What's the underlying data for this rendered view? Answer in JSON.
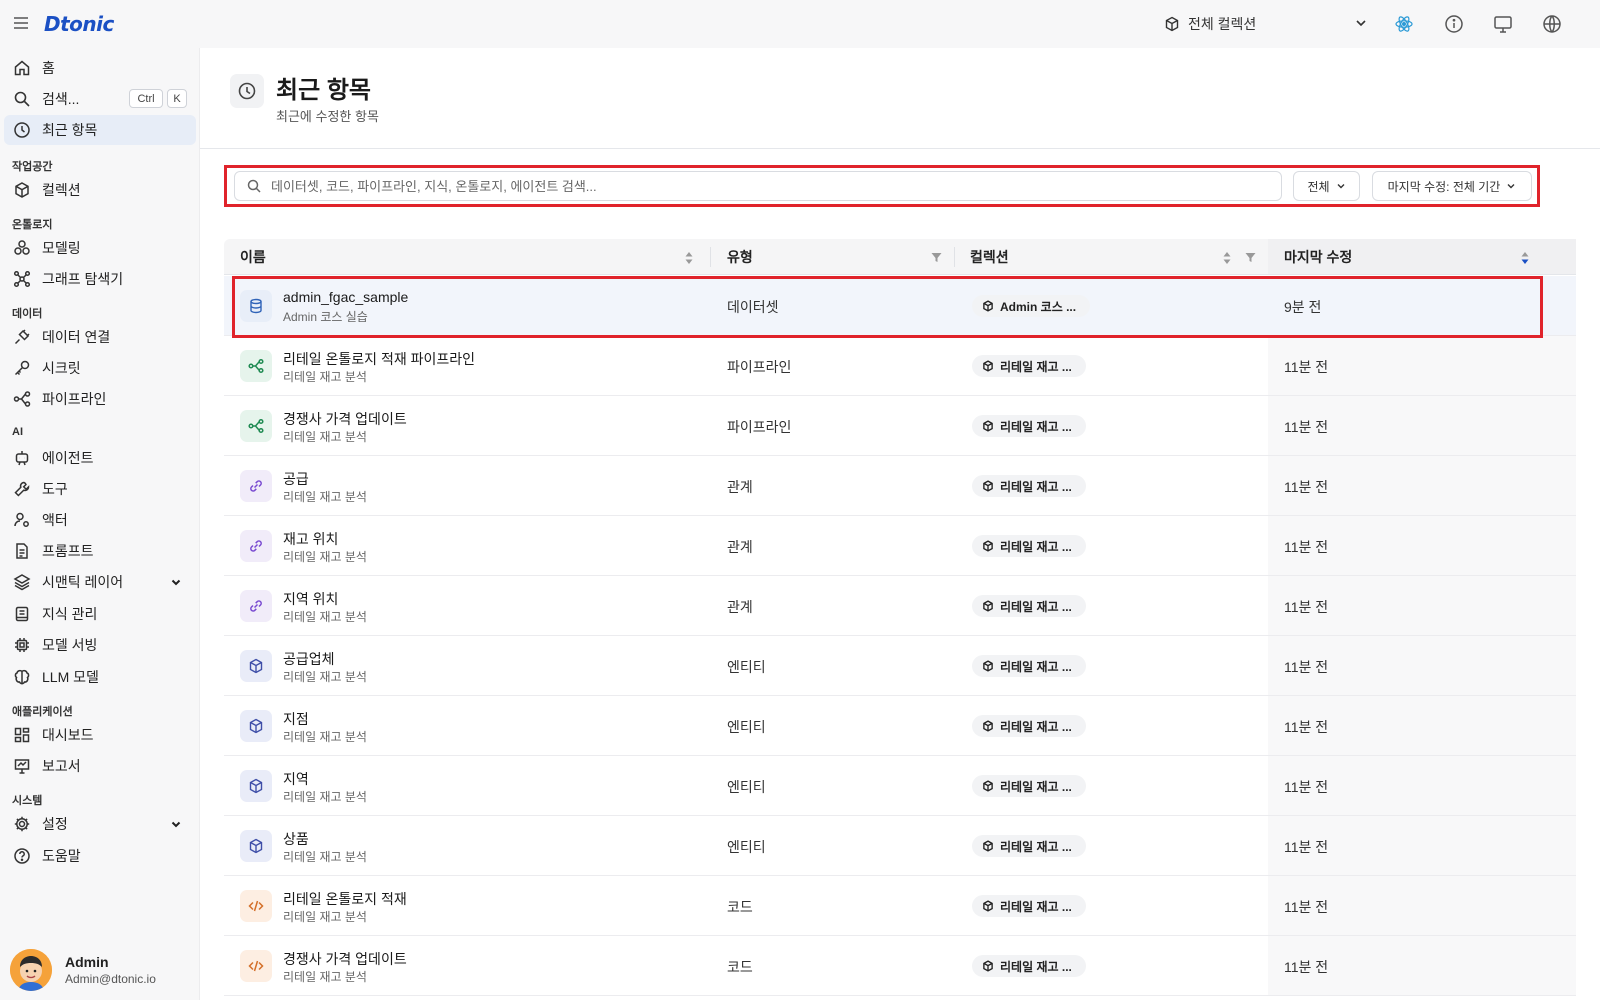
{
  "app": {
    "logo": "Dtonic"
  },
  "header": {
    "collection_selector": "전체 컬렉션"
  },
  "sidebar": {
    "items": {
      "home": "홈",
      "search": "검색...",
      "search_kbd": [
        "Ctrl",
        "K"
      ],
      "recent": "최근 항목",
      "collections": "컬렉션",
      "modeling": "모델링",
      "graph_explorer": "그래프 탐색기",
      "data_connection": "데이터 연결",
      "secret": "시크릿",
      "pipeline": "파이프라인",
      "agent": "에이전트",
      "tool": "도구",
      "actor": "액터",
      "prompt": "프롬프트",
      "semantic_layer": "시맨틱 레이어",
      "knowledge": "지식 관리",
      "model_serving": "모델 서빙",
      "llm_model": "LLM 모델",
      "dashboard": "대시보드",
      "report": "보고서",
      "settings": "설정",
      "help": "도움말"
    },
    "sections": {
      "workspace": "작업공간",
      "ontology": "온톨로지",
      "data": "데이터",
      "ai": "AI",
      "application": "애플리케이션",
      "system": "시스템"
    },
    "user": {
      "name": "Admin",
      "email": "Admin@dtonic.io"
    }
  },
  "page": {
    "title": "최근 항목",
    "subtitle": "최근에 수정한 항목"
  },
  "filters": {
    "search_placeholder": "데이터셋, 코드, 파이프라인, 지식, 온톨로지, 에이전트 검색...",
    "type_filter": "전체",
    "date_filter": "마지막 수정: 전체 기간"
  },
  "table": {
    "columns": {
      "name": "이름",
      "type": "유형",
      "collection": "컬렉션",
      "modified": "마지막 수정"
    },
    "rows": [
      {
        "name": "admin_fgac_sample",
        "sub": "Admin 코스 실습",
        "type": "데이터셋",
        "collection": "Admin 코스 ...",
        "modified": "9분 전",
        "icon": "database-icon"
      },
      {
        "name": "리테일 온톨로지 적재 파이프라인",
        "sub": "리테일 재고 분석",
        "type": "파이프라인",
        "collection": "리테일 재고 ...",
        "modified": "11분 전",
        "icon": "pipeline-icon"
      },
      {
        "name": "경쟁사 가격 업데이트",
        "sub": "리테일 재고 분석",
        "type": "파이프라인",
        "collection": "리테일 재고 ...",
        "modified": "11분 전",
        "icon": "pipeline-icon"
      },
      {
        "name": "공급",
        "sub": "리테일 재고 분석",
        "type": "관계",
        "collection": "리테일 재고 ...",
        "modified": "11분 전",
        "icon": "link-icon"
      },
      {
        "name": "재고 위치",
        "sub": "리테일 재고 분석",
        "type": "관계",
        "collection": "리테일 재고 ...",
        "modified": "11분 전",
        "icon": "link-icon"
      },
      {
        "name": "지역 위치",
        "sub": "리테일 재고 분석",
        "type": "관계",
        "collection": "리테일 재고 ...",
        "modified": "11분 전",
        "icon": "link-icon"
      },
      {
        "name": "공급업체",
        "sub": "리테일 재고 분석",
        "type": "엔티티",
        "collection": "리테일 재고 ...",
        "modified": "11분 전",
        "icon": "cube-icon"
      },
      {
        "name": "지점",
        "sub": "리테일 재고 분석",
        "type": "엔티티",
        "collection": "리테일 재고 ...",
        "modified": "11분 전",
        "icon": "cube-icon"
      },
      {
        "name": "지역",
        "sub": "리테일 재고 분석",
        "type": "엔티티",
        "collection": "리테일 재고 ...",
        "modified": "11분 전",
        "icon": "cube-icon"
      },
      {
        "name": "상품",
        "sub": "리테일 재고 분석",
        "type": "엔티티",
        "collection": "리테일 재고 ...",
        "modified": "11분 전",
        "icon": "cube-icon"
      },
      {
        "name": "리테일 온톨로지 적재",
        "sub": "리테일 재고 분석",
        "type": "코드",
        "collection": "리테일 재고 ...",
        "modified": "11분 전",
        "icon": "code-icon"
      },
      {
        "name": "경쟁사 가격 업데이트",
        "sub": "리테일 재고 분석",
        "type": "코드",
        "collection": "리테일 재고 ...",
        "modified": "11분 전",
        "icon": "code-icon"
      }
    ]
  },
  "colors": {
    "accent": "#1b50c4",
    "highlight_border": "#e0232b",
    "dataset_bg": "#e8eef8",
    "pipeline_bg": "#e6f4ec",
    "relation_bg": "#f1ecf9",
    "entity_bg": "#e9ecf8",
    "code_bg": "#fdeee2"
  }
}
